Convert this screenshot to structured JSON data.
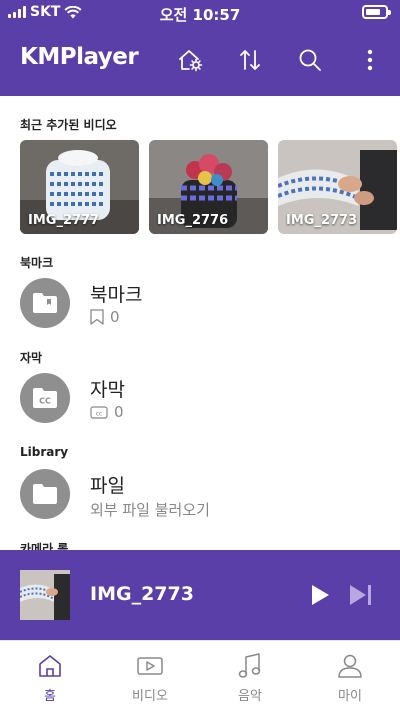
{
  "colors": {
    "brand": "#5b3fa8",
    "icon_gray": "#8f8f8f",
    "text_gray": "#888888"
  },
  "status_bar": {
    "carrier": "SKT",
    "time": "오전 10:57"
  },
  "app_bar": {
    "logo": "KMPlayer",
    "icons": [
      "home-settings-icon",
      "sort-icon",
      "search-icon",
      "more-icon"
    ]
  },
  "recent": {
    "title": "최근 추가된 비디오",
    "videos": [
      {
        "name": "IMG_2777"
      },
      {
        "name": "IMG_2776"
      },
      {
        "name": "IMG_2773"
      }
    ]
  },
  "bookmark": {
    "section": "북마크",
    "title": "북마크",
    "count": "0"
  },
  "subtitle": {
    "section": "자막",
    "title": "자막",
    "count": "0"
  },
  "library": {
    "section": "Library",
    "title": "파일",
    "subtitle": "외부 파일 불러오기"
  },
  "camera_roll": {
    "section": "카메라 롤"
  },
  "player": {
    "title": "IMG_2773"
  },
  "tabs": [
    {
      "label": "홈",
      "icon": "home-icon",
      "active": true
    },
    {
      "label": "비디오",
      "icon": "video-icon",
      "active": false
    },
    {
      "label": "음악",
      "icon": "music-icon",
      "active": false
    },
    {
      "label": "마이",
      "icon": "profile-icon",
      "active": false
    }
  ]
}
